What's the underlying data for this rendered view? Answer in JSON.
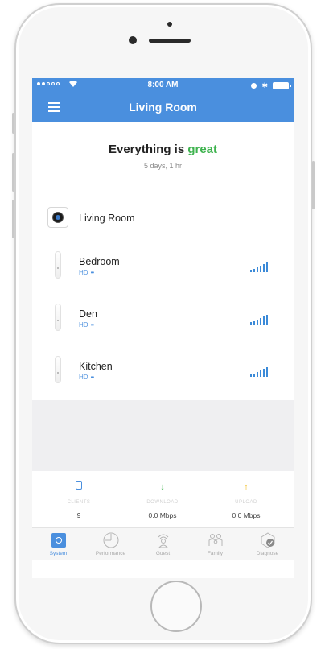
{
  "status_bar": {
    "time": "8:00 AM",
    "signal_dots": 2,
    "signal_empty_dots": 3,
    "wifi_icon": "wifi-icon",
    "alarm_icon": "alarm-icon",
    "bluetooth_icon": "bluetooth-icon",
    "battery_icon": "battery-icon"
  },
  "nav": {
    "title": "Living Room",
    "menu_icon": "hamburger-menu-icon"
  },
  "summary": {
    "headline_prefix": "Everything is ",
    "headline_status": "great",
    "uptime": "5 days, 1 hr"
  },
  "gateway": {
    "name": "Living Room",
    "icon": "gateway-device-icon"
  },
  "devices": [
    {
      "name": "Bedroom",
      "sub": "HD",
      "dots": "••",
      "signal_bars": 6
    },
    {
      "name": "Den",
      "sub": "HD",
      "dots": "••",
      "signal_bars": 6
    },
    {
      "name": "Kitchen",
      "sub": "HD",
      "dots": "••",
      "signal_bars": 6
    }
  ],
  "stats": [
    {
      "label": "CLIENTS",
      "value": "9",
      "icon": "phone-icon",
      "color": "#4a8fde"
    },
    {
      "label": "DOWNLOAD",
      "value": "0.0 Mbps",
      "icon": "download-arrow-icon",
      "color": "#3fb34f"
    },
    {
      "label": "UPLOAD",
      "value": "0.0 Mbps",
      "icon": "upload-arrow-icon",
      "color": "#f0b400"
    }
  ],
  "tabs": [
    {
      "label": "System",
      "icon": "system-icon",
      "active": true
    },
    {
      "label": "Performance",
      "icon": "performance-gauge-icon",
      "active": false
    },
    {
      "label": "Guest",
      "icon": "guest-icon",
      "active": false
    },
    {
      "label": "Family",
      "icon": "family-icon",
      "active": false
    },
    {
      "label": "Diagnose",
      "icon": "diagnose-icon",
      "active": false
    }
  ],
  "colors": {
    "accent": "#4a8fde",
    "good": "#3fb34f",
    "upload": "#f0b400"
  }
}
